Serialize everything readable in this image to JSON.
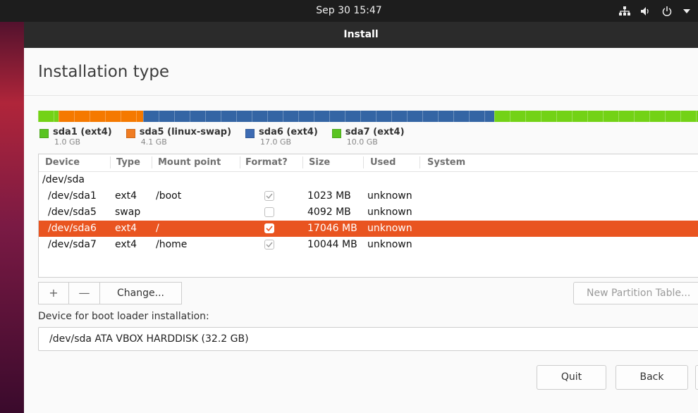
{
  "topbar": {
    "clock": "Sep 30  15:47",
    "tray_icons": [
      "network-icon",
      "volume-icon",
      "power-icon",
      "menu-arrow-icon"
    ]
  },
  "window": {
    "title": "Install"
  },
  "page": {
    "title": "Installation type"
  },
  "partition_bar": [
    {
      "name": "sda1",
      "color": "#73d216",
      "size_gb": 1.0
    },
    {
      "name": "sda5",
      "color": "#f57900",
      "size_gb": 4.1
    },
    {
      "name": "sda6",
      "color": "#3465a4",
      "size_gb": 17.0
    },
    {
      "name": "sda7",
      "color": "#73d216",
      "size_gb": 10.0
    }
  ],
  "legend": [
    {
      "name": "sda1 (ext4)",
      "size": "1.0 GB",
      "color": "#5ac421"
    },
    {
      "name": "sda5 (linux-swap)",
      "size": "4.1 GB",
      "color": "#f07c22"
    },
    {
      "name": "sda6 (ext4)",
      "size": "17.0 GB",
      "color": "#3d6bb3"
    },
    {
      "name": "sda7 (ext4)",
      "size": "10.0 GB",
      "color": "#5ac421"
    }
  ],
  "table": {
    "headers": [
      "Device",
      "Type",
      "Mount point",
      "Format?",
      "Size",
      "Used",
      "System"
    ],
    "group": "/dev/sda",
    "rows": [
      {
        "device": "/dev/sda1",
        "type": "ext4",
        "mount": "/boot",
        "format": true,
        "format_enabled": false,
        "size": "1023 MB",
        "used": "unknown",
        "system": "",
        "selected": false
      },
      {
        "device": "/dev/sda5",
        "type": "swap",
        "mount": "",
        "format": false,
        "format_enabled": false,
        "size": "4092 MB",
        "used": "unknown",
        "system": "",
        "selected": false
      },
      {
        "device": "/dev/sda6",
        "type": "ext4",
        "mount": "/",
        "format": true,
        "format_enabled": true,
        "size": "17046 MB",
        "used": "unknown",
        "system": "",
        "selected": true
      },
      {
        "device": "/dev/sda7",
        "type": "ext4",
        "mount": "/home",
        "format": true,
        "format_enabled": false,
        "size": "10044 MB",
        "used": "unknown",
        "system": "",
        "selected": false
      }
    ]
  },
  "buttons": {
    "add": "+",
    "remove": "—",
    "change": "Change...",
    "new_partition_table": "New Partition Table...",
    "quit": "Quit",
    "back": "Back"
  },
  "boot_loader": {
    "label": "Device for boot loader installation:",
    "value": "/dev/sda   ATA VBOX HARDDISK (32.2 GB)"
  }
}
